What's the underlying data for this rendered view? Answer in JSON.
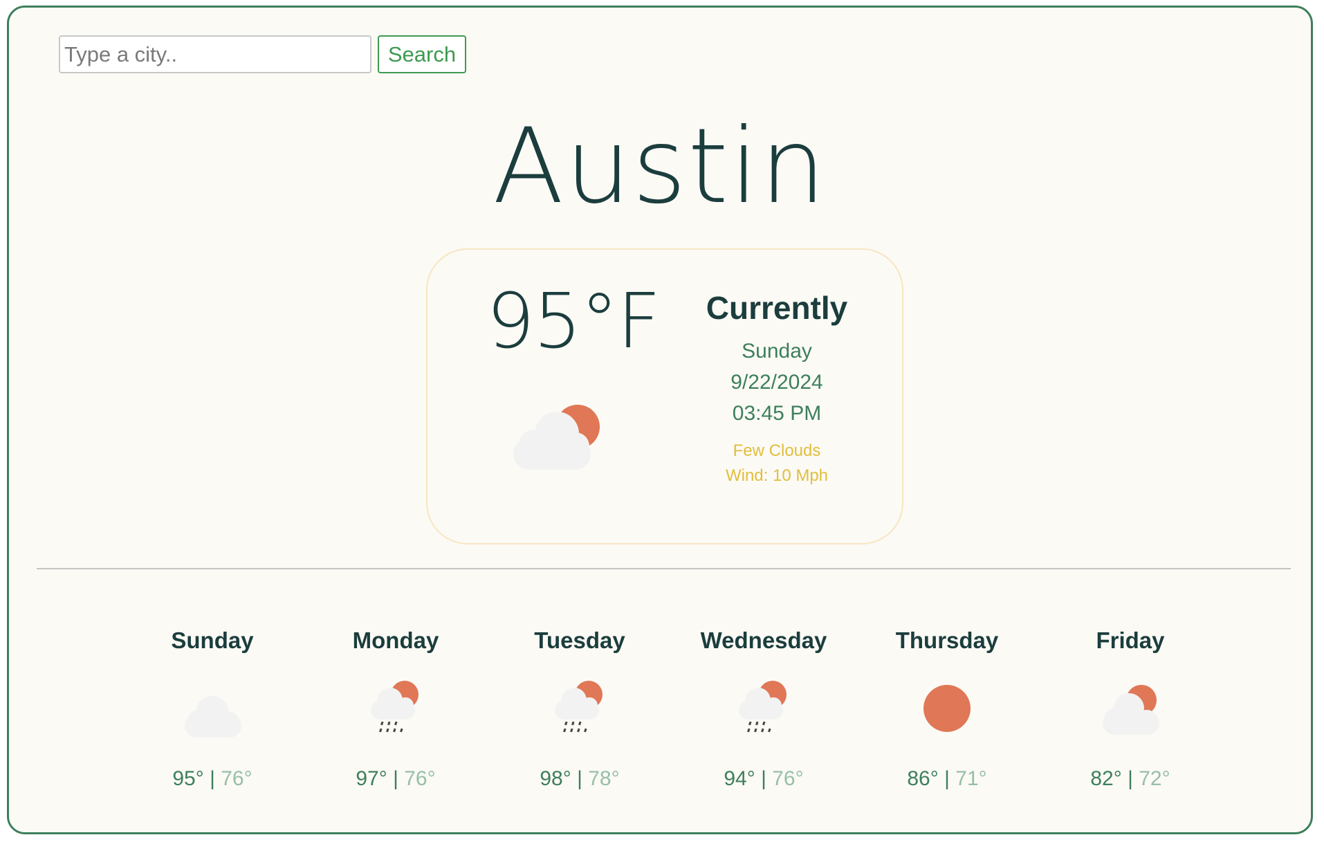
{
  "search": {
    "placeholder": "Type a city..",
    "value": "",
    "button_label": "Search"
  },
  "city": "Austin",
  "current": {
    "temperature": "95°F",
    "heading": "Currently",
    "day": "Sunday",
    "date": "9/22/2024",
    "time": "03:45 PM",
    "description": "Few Clouds",
    "wind": "Wind: 10 Mph",
    "icon": "few-clouds-icon"
  },
  "forecast": [
    {
      "day": "Sunday",
      "icon": "cloud-icon",
      "high": "95°",
      "low": "76°"
    },
    {
      "day": "Monday",
      "icon": "rain-sun-icon",
      "high": "97°",
      "low": "76°"
    },
    {
      "day": "Tuesday",
      "icon": "rain-sun-icon",
      "high": "98°",
      "low": "78°"
    },
    {
      "day": "Wednesday",
      "icon": "rain-sun-icon",
      "high": "94°",
      "low": "76°"
    },
    {
      "day": "Thursday",
      "icon": "sun-icon",
      "high": "86°",
      "low": "71°"
    },
    {
      "day": "Friday",
      "icon": "few-clouds-icon",
      "high": "82°",
      "low": "72°"
    }
  ],
  "separator": "|",
  "colors": {
    "frame_border": "#3d7f5b",
    "background": "#fcfaf5",
    "heading": "#1b3d3d",
    "accent_green": "#3d7f5b",
    "accent_yellow": "#e0be3c",
    "sun": "#e07756",
    "cloud": "#f2f2f2",
    "low_temp": "#96bfa7"
  }
}
